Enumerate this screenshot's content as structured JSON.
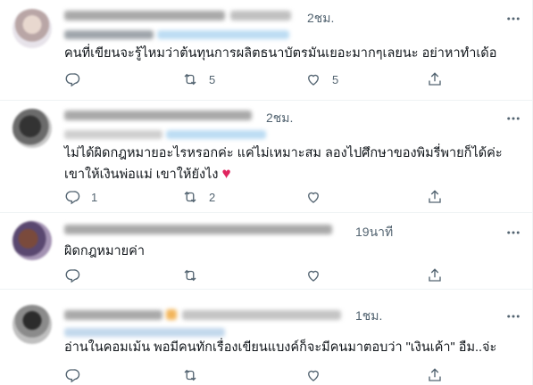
{
  "tweets": [
    {
      "time": "2ชม.",
      "text": "คนที่เขียนจะรู้ไหมว่าต้นทุนการผลิตธนาบัตรมันเยอะมากๆเลยนะ อย่าหาทำเด้อ",
      "replies": "",
      "retweets": "5",
      "likes": "5"
    },
    {
      "time": "2ชม.",
      "text_line1": "ไม่ได้ผิดกฎหมายอะไรหรอกค่ะ แค่ไม่เหมาะสม ลองไปศึกษาของพิมรี่พายก็ได้ค่ะ",
      "text_line2": "เขาให้เงินพ่อแม่ เขาให้ยังไง",
      "emoji": "♥",
      "replies": "1",
      "retweets": "2",
      "likes": ""
    },
    {
      "time": "19นาที",
      "text": "ผิดกฎหมายค่า",
      "replies": "",
      "retweets": "",
      "likes": ""
    },
    {
      "time": "1ชม.",
      "text": "อ่านในคอมเม้น พอมีคนทักเรื่องเขียนแบงค์ก็จะมีคนมาตอบว่า \"เงินเค้า\" อืม..จ่ะ",
      "replies": "",
      "retweets": "",
      "likes": ""
    }
  ],
  "icons": {
    "reply": "reply-icon",
    "retweet": "retweet-icon",
    "like": "heart-icon",
    "share": "share-icon",
    "more": "more-icon"
  }
}
